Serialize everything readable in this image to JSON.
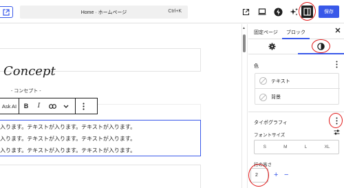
{
  "topbar": {
    "page_title": "Home · ホームページ",
    "shortcut": "Ctrl+K",
    "save_label": "保存"
  },
  "canvas": {
    "heading": "Concept",
    "subtitle": "- コンセプト -",
    "toolbar": {
      "ai_label": "Ask AI",
      "bold": "B",
      "italic": "I"
    },
    "paragraph_lines": [
      "入ります。テキストが入ります。テキストが入ります。",
      "入ります。テキストが入ります。テキストが入ります。",
      "入ります。テキストが入ります。テキストが入ります。"
    ]
  },
  "sidebar": {
    "tabs": {
      "page": "固定ページ",
      "block": "ブロック"
    },
    "color": {
      "title": "色",
      "items": [
        {
          "label": "テキスト"
        },
        {
          "label": "背景"
        }
      ]
    },
    "typography": {
      "title": "タイポグラフィ",
      "font_size_label": "フォントサイズ",
      "sizes": [
        "S",
        "M",
        "L",
        "XL"
      ],
      "line_height_label": "行の高さ",
      "line_height_value": "2"
    }
  },
  "colors": {
    "accent": "#3858e9",
    "highlight": "#e01515"
  }
}
